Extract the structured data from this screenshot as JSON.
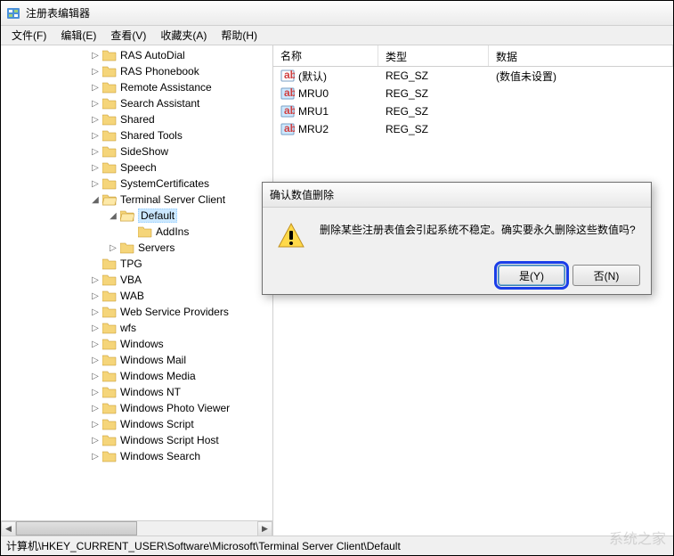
{
  "window": {
    "title": "注册表编辑器"
  },
  "menu": {
    "file": "文件(F)",
    "edit": "编辑(E)",
    "view": "查看(V)",
    "favorites": "收藏夹(A)",
    "help": "帮助(H)"
  },
  "tree": {
    "items": [
      {
        "label": "RAS AutoDial",
        "indent": 5,
        "toggle": "▷"
      },
      {
        "label": "RAS Phonebook",
        "indent": 5,
        "toggle": "▷"
      },
      {
        "label": "Remote Assistance",
        "indent": 5,
        "toggle": "▷"
      },
      {
        "label": "Search Assistant",
        "indent": 5,
        "toggle": "▷"
      },
      {
        "label": "Shared",
        "indent": 5,
        "toggle": "▷"
      },
      {
        "label": "Shared Tools",
        "indent": 5,
        "toggle": "▷"
      },
      {
        "label": "SideShow",
        "indent": 5,
        "toggle": "▷"
      },
      {
        "label": "Speech",
        "indent": 5,
        "toggle": "▷"
      },
      {
        "label": "SystemCertificates",
        "indent": 5,
        "toggle": "▷"
      },
      {
        "label": "Terminal Server Client",
        "indent": 5,
        "toggle": "◢",
        "open": true
      },
      {
        "label": "Default",
        "indent": 6,
        "toggle": "◢",
        "selected": true,
        "open": true
      },
      {
        "label": "AddIns",
        "indent": 7,
        "toggle": ""
      },
      {
        "label": "Servers",
        "indent": 6,
        "toggle": "▷"
      },
      {
        "label": "TPG",
        "indent": 5,
        "toggle": ""
      },
      {
        "label": "VBA",
        "indent": 5,
        "toggle": "▷"
      },
      {
        "label": "WAB",
        "indent": 5,
        "toggle": "▷"
      },
      {
        "label": "Web Service Providers",
        "indent": 5,
        "toggle": "▷"
      },
      {
        "label": "wfs",
        "indent": 5,
        "toggle": "▷"
      },
      {
        "label": "Windows",
        "indent": 5,
        "toggle": "▷"
      },
      {
        "label": "Windows Mail",
        "indent": 5,
        "toggle": "▷"
      },
      {
        "label": "Windows Media",
        "indent": 5,
        "toggle": "▷"
      },
      {
        "label": "Windows NT",
        "indent": 5,
        "toggle": "▷"
      },
      {
        "label": "Windows Photo Viewer",
        "indent": 5,
        "toggle": "▷"
      },
      {
        "label": "Windows Script",
        "indent": 5,
        "toggle": "▷"
      },
      {
        "label": "Windows Script Host",
        "indent": 5,
        "toggle": "▷"
      },
      {
        "label": "Windows Search",
        "indent": 5,
        "toggle": "▷"
      }
    ]
  },
  "list": {
    "headers": {
      "name": "名称",
      "type": "类型",
      "data": "数据"
    },
    "rows": [
      {
        "name": "(默认)",
        "type": "REG_SZ",
        "data": "(数值未设置)",
        "highlighted": false
      },
      {
        "name": "MRU0",
        "type": "REG_SZ",
        "data": "",
        "highlighted": true
      },
      {
        "name": "MRU1",
        "type": "REG_SZ",
        "data": "",
        "highlighted": true
      },
      {
        "name": "MRU2",
        "type": "REG_SZ",
        "data": "",
        "highlighted": true
      }
    ]
  },
  "dialog": {
    "title": "确认数值删除",
    "message": "删除某些注册表值会引起系统不稳定。确实要永久删除这些数值吗?",
    "yes": "是(Y)",
    "no": "否(N)"
  },
  "statusbar": {
    "path": "计算机\\HKEY_CURRENT_USER\\Software\\Microsoft\\Terminal Server Client\\Default"
  },
  "watermark": "系统之家"
}
